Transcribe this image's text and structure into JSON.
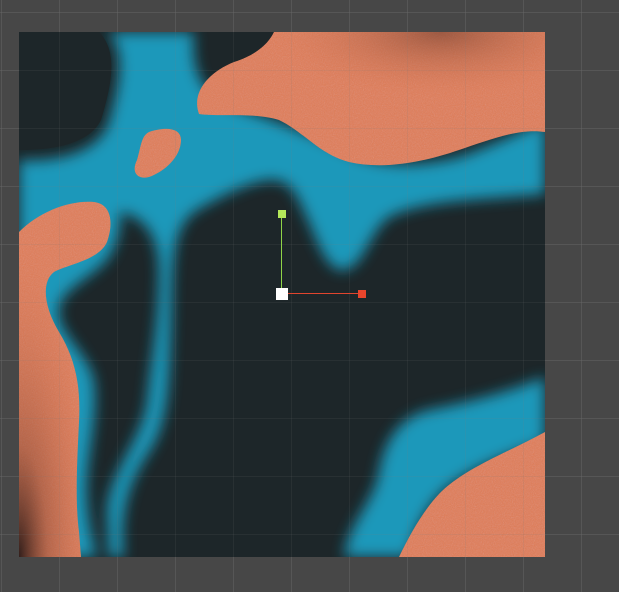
{
  "scene": {
    "background_color": "#474747",
    "grid_color": "#5a5a5a"
  },
  "terrain": {
    "colors": {
      "deep": "#1d2629",
      "shore": "#1a9fc2",
      "land": "#e07b54",
      "land_dark": "#3a2320"
    }
  },
  "gizmo": {
    "tool": "move-tool",
    "axis_colors": {
      "x": "#e0452e",
      "y": "#8fd447",
      "center": "#ffffff"
    }
  }
}
